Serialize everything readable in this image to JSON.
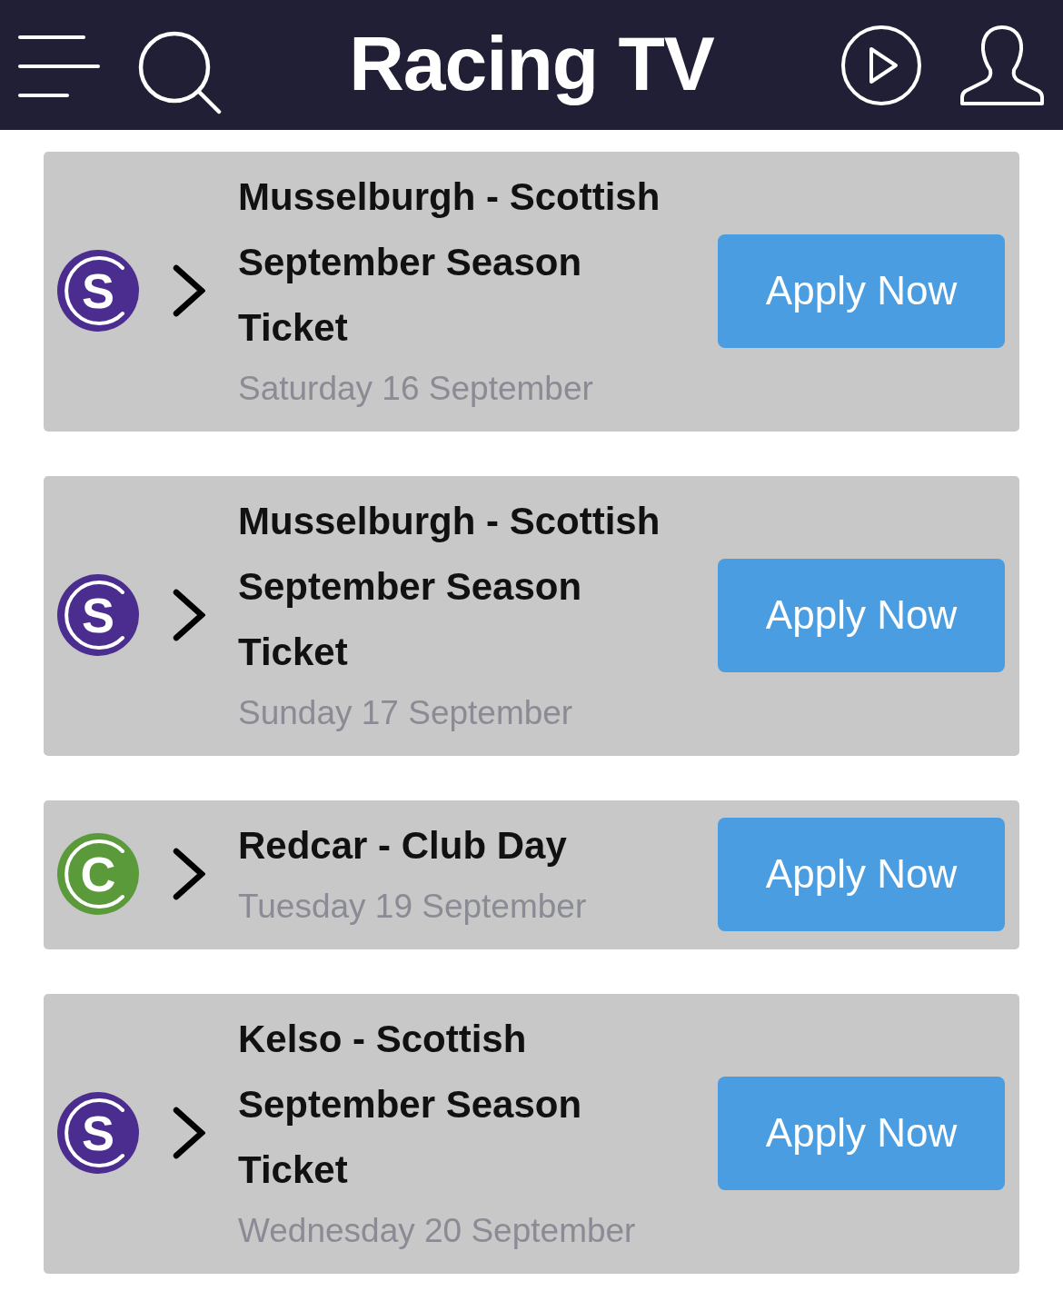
{
  "header": {
    "logo": "Racing TV"
  },
  "events": [
    {
      "badge": "S",
      "color": "#4b2d8f",
      "title": "Musselburgh - Scottish September Season Ticket",
      "date": "Saturday 16 September",
      "action": "Apply Now"
    },
    {
      "badge": "S",
      "color": "#4b2d8f",
      "title": "Musselburgh - Scottish September Season Ticket",
      "date": "Sunday 17 September",
      "action": "Apply Now"
    },
    {
      "badge": "C",
      "color": "#5a9a3a",
      "title": "Redcar - Club Day",
      "date": "Tuesday 19 September",
      "action": "Apply Now"
    },
    {
      "badge": "S",
      "color": "#4b2d8f",
      "title": "Kelso - Scottish September Season Ticket",
      "date": "Wednesday 20 September",
      "action": "Apply Now"
    }
  ]
}
